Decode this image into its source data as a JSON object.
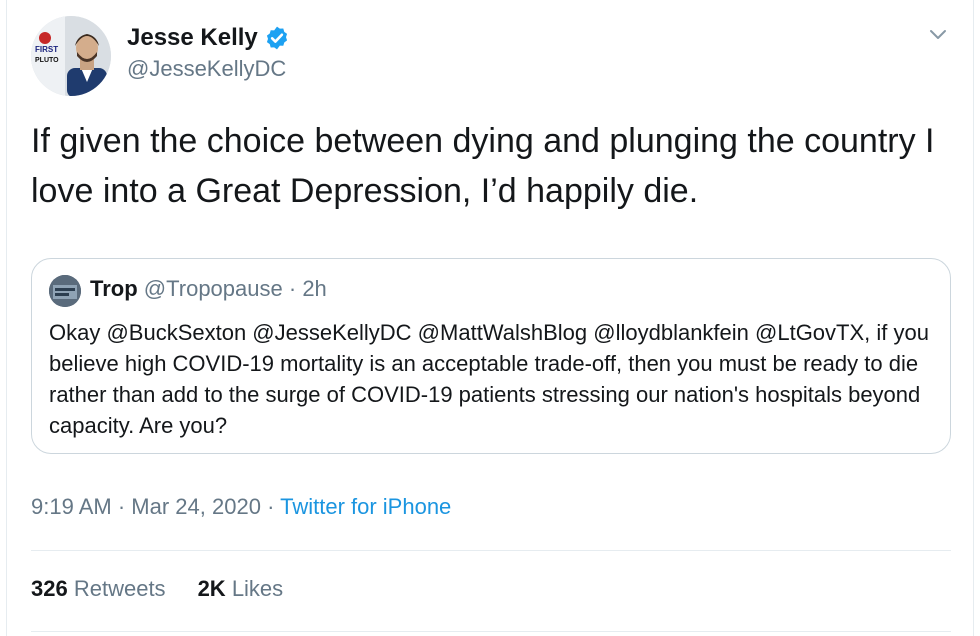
{
  "author": {
    "display_name": "Jesse Kelly",
    "handle": "@JesseKellyDC",
    "verified": true,
    "avatar_badge": [
      "FIRST",
      "PLUTO"
    ]
  },
  "tweet": {
    "text": "If given the choice between dying and plunging the country I love into a Great Depression, I’d happily die."
  },
  "quoted_tweet": {
    "display_name": "Trop",
    "handle": "@Tropopause",
    "separator": "·",
    "age": "2h",
    "text": "Okay @BuckSexton @JesseKellyDC @MattWalshBlog @lloydblankfein @LtGovTX, if you believe high COVID-19 mortality is an acceptable trade-off, then you must be ready to die rather than add to the surge of COVID-19 patients stressing our nation's hospitals beyond capacity. Are you?"
  },
  "meta": {
    "time": "9:19 AM",
    "date": "Mar 24, 2020",
    "separator": "·",
    "source": "Twitter for iPhone"
  },
  "stats": {
    "retweets_count": "326",
    "retweets_label": "Retweets",
    "likes_count": "2K",
    "likes_label": "Likes"
  },
  "colors": {
    "link": "#1b95e0",
    "verified": "#1da1f2",
    "secondary_text": "#657786",
    "border": "#ccd6dd"
  },
  "icons": {
    "verified": "verified-badge-icon",
    "caret": "chevron-down-icon"
  }
}
